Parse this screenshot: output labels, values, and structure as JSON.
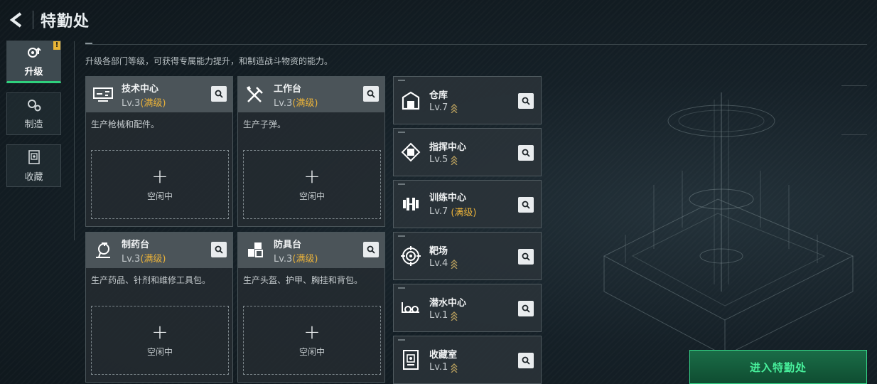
{
  "header": {
    "title": "特勤处"
  },
  "sidenav": {
    "items": [
      {
        "label": "升级",
        "icon": "upgrade-gear-icon",
        "active": true,
        "badge": "!"
      },
      {
        "label": "制造",
        "icon": "craft-gears-icon",
        "active": false
      },
      {
        "label": "收藏",
        "icon": "collection-icon",
        "active": false
      }
    ]
  },
  "description": "升级各部门等级，可获得专属能力提升，和制造战斗物资的能力。",
  "workstations": [
    {
      "name": "技术中心",
      "level": "Lv.3",
      "max_tag": "(满级)",
      "desc": "生产枪械和配件。",
      "slot_label": "空闲中",
      "plus": "+",
      "icon": "tech-console-icon"
    },
    {
      "name": "工作台",
      "level": "Lv.3",
      "max_tag": "(满级)",
      "desc": "生产子弹。",
      "slot_label": "空闲中",
      "plus": "+",
      "icon": "tools-icon"
    },
    {
      "name": "制药台",
      "level": "Lv.3",
      "max_tag": "(满级)",
      "desc": "生产药品、针剂和维修工具包。",
      "slot_label": "空闲中",
      "plus": "+",
      "icon": "microscope-icon"
    },
    {
      "name": "防具台",
      "level": "Lv.3",
      "max_tag": "(满级)",
      "desc": "生产头盔、护甲、胸挂和背包。",
      "slot_label": "空闲中",
      "plus": "+",
      "icon": "armor-icon"
    }
  ],
  "facilities": [
    {
      "name": "仓库",
      "level": "Lv.7",
      "max_tag": "",
      "upgradable": true,
      "icon": "warehouse-icon"
    },
    {
      "name": "指挥中心",
      "level": "Lv.5",
      "max_tag": "",
      "upgradable": true,
      "icon": "command-chip-icon"
    },
    {
      "name": "训练中心",
      "level": "Lv.7",
      "max_tag": "(满级)",
      "upgradable": false,
      "icon": "dumbbell-icon"
    },
    {
      "name": "靶场",
      "level": "Lv.4",
      "max_tag": "",
      "upgradable": true,
      "icon": "target-icon"
    },
    {
      "name": "潜水中心",
      "level": "Lv.1",
      "max_tag": "",
      "upgradable": true,
      "icon": "diving-mask-icon"
    },
    {
      "name": "收藏室",
      "level": "Lv.1",
      "max_tag": "",
      "upgradable": true,
      "icon": "trophy-case-icon"
    }
  ],
  "enter_button": "进入特勤处",
  "colors": {
    "accent_green": "#36d88a",
    "max_gold": "#e8b13a",
    "badge_yellow": "#e9b536"
  }
}
